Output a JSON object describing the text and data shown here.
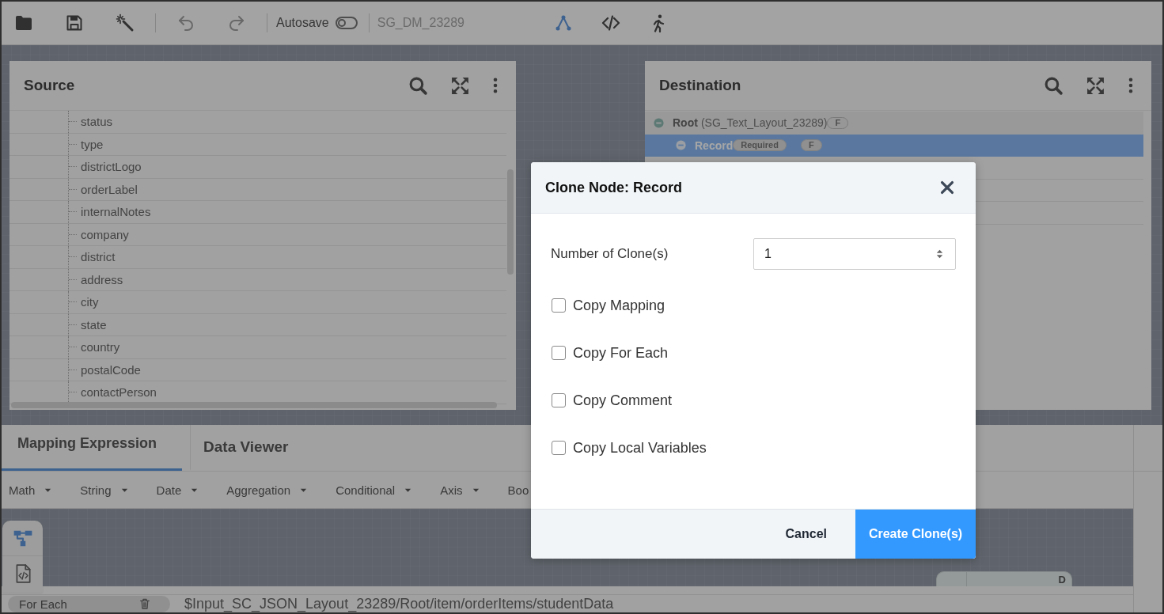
{
  "toolbar": {
    "tools": [
      {
        "kind": "folder",
        "disabled": false
      },
      {
        "kind": "save",
        "disabled": false
      },
      {
        "kind": "magic",
        "disabled": false
      }
    ],
    "history": [
      {
        "kind": "undo",
        "disabled": true
      },
      {
        "kind": "redo",
        "disabled": true
      }
    ],
    "autosave": {
      "label": "Autosave",
      "on": false
    },
    "map_name": "SG_DM_23289",
    "views": [
      {
        "kind": "graph",
        "selected": true
      },
      {
        "kind": "code",
        "selected": false
      },
      {
        "kind": "run",
        "selected": false
      }
    ]
  },
  "source_panel": {
    "title": "Source",
    "fields": [
      "status",
      "type",
      "districtLogo",
      "orderLabel",
      "internalNotes",
      "company",
      "district",
      "address",
      "city",
      "state",
      "country",
      "postalCode",
      "contactPerson"
    ]
  },
  "destination_panel": {
    "title": "Destination",
    "tree": [
      {
        "name": "Root",
        "detail": "(SG_Text_Layout_23289)",
        "badges": [
          "F"
        ],
        "expanded": true,
        "selected": false,
        "children": [
          {
            "name": "Record",
            "badges": [
              "Required",
              "F"
            ],
            "expanded": true,
            "selected": true
          }
        ]
      }
    ]
  },
  "bottom_panel": {
    "tabs": [
      {
        "label": "Mapping Expression",
        "selected": true
      },
      {
        "label": "Data Viewer",
        "selected": false
      }
    ],
    "function_menus": [
      {
        "label": "Math",
        "caret": true
      },
      {
        "label": "String",
        "caret": true
      },
      {
        "label": "Date",
        "caret": true
      },
      {
        "label": "Aggregation",
        "caret": true
      },
      {
        "label": "Conditional",
        "caret": true
      },
      {
        "label": "Axis",
        "caret": true
      },
      {
        "label": "Boo",
        "caret": false
      }
    ],
    "side_tools": [
      {
        "kind": "tree",
        "selected": true
      },
      {
        "kind": "code-file",
        "selected": false
      }
    ],
    "canvas_node": {
      "label": "D"
    },
    "for_each_chip": {
      "label": "For Each"
    },
    "path": "$Input_SC_JSON_Layout_23289/Root/item/orderItems/studentData"
  },
  "dialog": {
    "title": "Clone Node: Record",
    "clone_count": {
      "label": "Number of Clone(s)",
      "value": "1"
    },
    "options": [
      {
        "label": "Copy Mapping",
        "checked": false
      },
      {
        "label": "Copy For Each",
        "checked": false
      },
      {
        "label": "Copy Comment",
        "checked": false
      },
      {
        "label": "Copy Local Variables",
        "checked": false
      }
    ],
    "buttons": [
      {
        "label": "Cancel",
        "kind": "secondary"
      },
      {
        "label": "Create Clone(s)",
        "kind": "primary"
      }
    ]
  }
}
